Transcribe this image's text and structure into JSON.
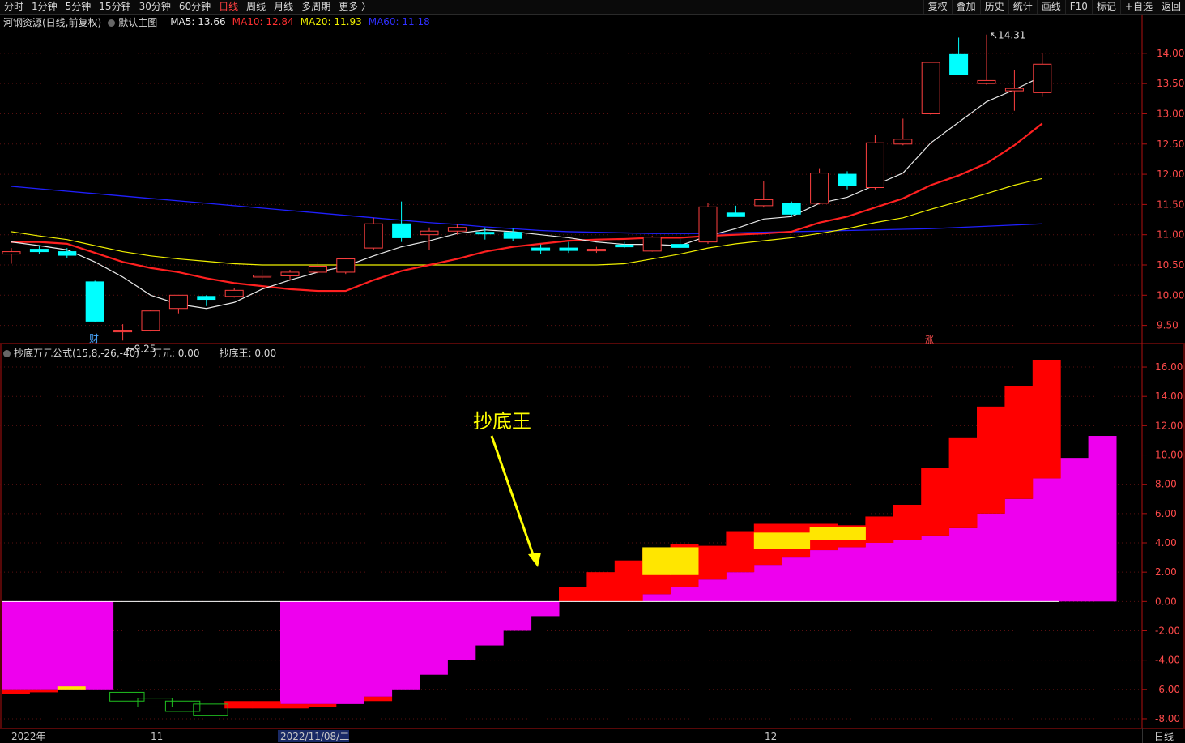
{
  "timeframes": [
    "分时",
    "1分钟",
    "5分钟",
    "15分钟",
    "30分钟",
    "60分钟",
    "日线",
    "周线",
    "月线",
    "多周期",
    "更多 〉"
  ],
  "active_timeframe_index": 6,
  "toolbar": [
    "复权",
    "叠加",
    "历史",
    "统计",
    "画线",
    "F10",
    "标记",
    "+自选",
    "返回"
  ],
  "main_info": {
    "stock": "河钢资源(日线,前复权)",
    "main_chart": "默认主图",
    "ma5": "MA5: 13.66",
    "ma10": "MA10: 12.84",
    "ma20": "MA20: 11.93",
    "ma60": "MA60: 11.18"
  },
  "indicator_info": {
    "name": "抄底万元公式(15,8,-26,-40)",
    "wanyuan": "万元: 0.00",
    "chaodiwang": "抄底王: 0.00"
  },
  "colors": {
    "up": "#ff4040",
    "down": "#00ffff",
    "ma5": "#e8e8e8",
    "ma10": "#ff2020",
    "ma20": "#f0f000",
    "ma60": "#2020ff",
    "magenta": "#ee00ee",
    "red": "#ff0000",
    "yellow": "#ffe600",
    "green": "#20c020",
    "axis": "#b01010",
    "annotation": "#ffff00"
  },
  "price_axis": [
    "14.00",
    "13.50",
    "13.00",
    "12.50",
    "12.00",
    "11.50",
    "11.00",
    "10.50",
    "10.00",
    "9.50"
  ],
  "indicator_axis": [
    "16.00",
    "14.00",
    "12.00",
    "10.00",
    "8.00",
    "6.00",
    "4.00",
    "2.00",
    "0.00",
    "-2.00",
    "-4.00",
    "-6.00",
    "-8.00"
  ],
  "date_labels": [
    "2022年",
    "11",
    "2022/11/08/二",
    "12"
  ],
  "markers": {
    "low": "9.25",
    "high": "14.31",
    "cai": "财",
    "zhang": "涨"
  },
  "annotation": "抄底王",
  "footer_label": "日线",
  "chart_data": {
    "type": "candlestick",
    "price_range": [
      9.2,
      14.4
    ],
    "candles": [
      {
        "o": 10.68,
        "h": 10.78,
        "l": 10.52,
        "c": 10.72
      },
      {
        "o": 10.76,
        "h": 10.82,
        "l": 10.68,
        "c": 10.72
      },
      {
        "o": 10.72,
        "h": 10.78,
        "l": 10.62,
        "c": 10.66
      },
      {
        "o": 10.22,
        "h": 10.24,
        "l": 9.55,
        "c": 9.57
      },
      {
        "o": 9.42,
        "h": 9.52,
        "l": 9.25,
        "c": 9.42
      },
      {
        "o": 9.42,
        "h": 9.76,
        "l": 9.4,
        "c": 9.74
      },
      {
        "o": 9.78,
        "h": 10.0,
        "l": 9.7,
        "c": 10.0
      },
      {
        "o": 9.98,
        "h": 10.0,
        "l": 9.82,
        "c": 9.93
      },
      {
        "o": 9.98,
        "h": 10.12,
        "l": 9.96,
        "c": 10.08
      },
      {
        "o": 10.3,
        "h": 10.42,
        "l": 10.25,
        "c": 10.33
      },
      {
        "o": 10.32,
        "h": 10.42,
        "l": 10.25,
        "c": 10.38
      },
      {
        "o": 10.38,
        "h": 10.55,
        "l": 10.35,
        "c": 10.48
      },
      {
        "o": 10.38,
        "h": 10.62,
        "l": 10.35,
        "c": 10.6
      },
      {
        "o": 10.78,
        "h": 11.28,
        "l": 10.75,
        "c": 11.18
      },
      {
        "o": 11.18,
        "h": 11.55,
        "l": 10.88,
        "c": 10.95
      },
      {
        "o": 11.0,
        "h": 11.12,
        "l": 10.75,
        "c": 11.06
      },
      {
        "o": 11.06,
        "h": 11.18,
        "l": 11.0,
        "c": 11.12
      },
      {
        "o": 11.04,
        "h": 11.12,
        "l": 10.92,
        "c": 11.02
      },
      {
        "o": 11.04,
        "h": 11.1,
        "l": 10.9,
        "c": 10.94
      },
      {
        "o": 10.78,
        "h": 10.84,
        "l": 10.68,
        "c": 10.74
      },
      {
        "o": 10.78,
        "h": 10.88,
        "l": 10.7,
        "c": 10.74
      },
      {
        "o": 10.75,
        "h": 10.8,
        "l": 10.7,
        "c": 10.76
      },
      {
        "o": 10.83,
        "h": 10.88,
        "l": 10.78,
        "c": 10.8
      },
      {
        "o": 10.73,
        "h": 10.98,
        "l": 10.72,
        "c": 10.96
      },
      {
        "o": 10.84,
        "h": 10.93,
        "l": 10.78,
        "c": 10.79
      },
      {
        "o": 10.88,
        "h": 11.52,
        "l": 10.85,
        "c": 11.46
      },
      {
        "o": 11.36,
        "h": 11.48,
        "l": 11.3,
        "c": 11.3
      },
      {
        "o": 11.48,
        "h": 11.88,
        "l": 11.45,
        "c": 11.58
      },
      {
        "o": 11.52,
        "h": 11.55,
        "l": 11.3,
        "c": 11.34
      },
      {
        "o": 11.52,
        "h": 12.1,
        "l": 11.5,
        "c": 12.02
      },
      {
        "o": 12.0,
        "h": 12.05,
        "l": 11.75,
        "c": 11.82
      },
      {
        "o": 11.78,
        "h": 12.65,
        "l": 11.75,
        "c": 12.52
      },
      {
        "o": 12.5,
        "h": 12.92,
        "l": 12.48,
        "c": 12.58
      },
      {
        "o": 13.0,
        "h": 13.85,
        "l": 12.98,
        "c": 13.85
      },
      {
        "o": 13.98,
        "h": 14.26,
        "l": 13.65,
        "c": 13.65
      },
      {
        "o": 13.5,
        "h": 14.31,
        "l": 13.48,
        "c": 13.55
      },
      {
        "o": 13.38,
        "h": 13.72,
        "l": 13.05,
        "c": 13.42
      },
      {
        "o": 13.35,
        "h": 14.0,
        "l": 13.28,
        "c": 13.82
      }
    ],
    "ma5": [
      10.88,
      10.82,
      10.75,
      10.55,
      10.3,
      10.0,
      9.85,
      9.78,
      9.88,
      10.1,
      10.25,
      10.38,
      10.48,
      10.65,
      10.8,
      10.9,
      11.02,
      11.08,
      11.05,
      11.0,
      10.95,
      10.88,
      10.84,
      10.84,
      10.82,
      10.98,
      11.1,
      11.26,
      11.3,
      11.52,
      11.62,
      11.82,
      12.02,
      12.52,
      12.86,
      13.2,
      13.4,
      13.62
    ],
    "ma10": [
      10.88,
      10.88,
      10.85,
      10.7,
      10.55,
      10.45,
      10.38,
      10.28,
      10.2,
      10.15,
      10.1,
      10.07,
      10.07,
      10.25,
      10.4,
      10.5,
      10.6,
      10.72,
      10.8,
      10.85,
      10.9,
      10.92,
      10.93,
      10.95,
      10.95,
      10.98,
      11.0,
      11.02,
      11.05,
      11.2,
      11.3,
      11.45,
      11.6,
      11.82,
      11.98,
      12.18,
      12.48,
      12.84
    ],
    "ma20": [
      11.05,
      10.98,
      10.92,
      10.82,
      10.72,
      10.65,
      10.6,
      10.56,
      10.52,
      10.5,
      10.5,
      10.5,
      10.5,
      10.5,
      10.5,
      10.5,
      10.5,
      10.5,
      10.5,
      10.5,
      10.5,
      10.5,
      10.52,
      10.6,
      10.68,
      10.78,
      10.85,
      10.9,
      10.95,
      11.02,
      11.1,
      11.2,
      11.28,
      11.42,
      11.55,
      11.68,
      11.82,
      11.93
    ],
    "ma60": [
      11.8,
      11.76,
      11.72,
      11.68,
      11.64,
      11.6,
      11.56,
      11.52,
      11.48,
      11.44,
      11.4,
      11.36,
      11.32,
      11.28,
      11.24,
      11.2,
      11.17,
      11.13,
      11.1,
      11.07,
      11.05,
      11.04,
      11.03,
      11.02,
      11.02,
      11.02,
      11.03,
      11.04,
      11.05,
      11.06,
      11.07,
      11.08,
      11.09,
      11.1,
      11.12,
      11.14,
      11.16,
      11.18
    ],
    "indicator_range": [
      -8.5,
      16.5
    ],
    "magenta": [
      -6,
      -6,
      -6,
      -6,
      0,
      0,
      0,
      0,
      0,
      0,
      -7,
      -7,
      -7,
      -6.5,
      -6,
      -5,
      -4,
      -3,
      -2,
      -1,
      0,
      0,
      0,
      0.5,
      1,
      1.5,
      2,
      2.5,
      3,
      3.5,
      3.7,
      4,
      4.2,
      4.5,
      5,
      6,
      7,
      8.4,
      9.8,
      11.3
    ],
    "red": [
      -6.3,
      -6.2,
      -5.2,
      -5.4,
      0,
      0,
      0,
      0,
      -7.3,
      -7.3,
      -7.3,
      -7.2,
      -7.0,
      -6.8,
      -5.7,
      -4.9,
      -3.8,
      -2.7,
      -1.7,
      -0.5,
      1.0,
      2.0,
      2.8,
      3.6,
      3.9,
      3.8,
      4.8,
      5.3,
      5.3,
      5.3,
      5.2,
      5.8,
      6.6,
      9.1,
      11.2,
      13.3,
      14.7,
      16.5
    ],
    "yellow_bars": [
      {
        "i": 2,
        "lo": -6.0,
        "hi": -5.8
      },
      {
        "i": 23,
        "lo": 1.8,
        "hi": 3.7
      },
      {
        "i": 24,
        "lo": 1.8,
        "hi": 3.7
      },
      {
        "i": 27,
        "lo": 3.6,
        "hi": 4.7
      },
      {
        "i": 28,
        "lo": 3.6,
        "hi": 4.7
      },
      {
        "i": 29,
        "lo": 4.2,
        "hi": 5.1
      },
      {
        "i": 30,
        "lo": 4.2,
        "hi": 5.1
      }
    ],
    "green_boxes": [
      {
        "i": 4,
        "lo": -6.8,
        "hi": -6.2
      },
      {
        "i": 5,
        "lo": -7.2,
        "hi": -6.6
      },
      {
        "i": 6,
        "lo": -7.5,
        "hi": -6.8
      },
      {
        "i": 7,
        "lo": -7.8,
        "hi": -7.0
      }
    ]
  }
}
